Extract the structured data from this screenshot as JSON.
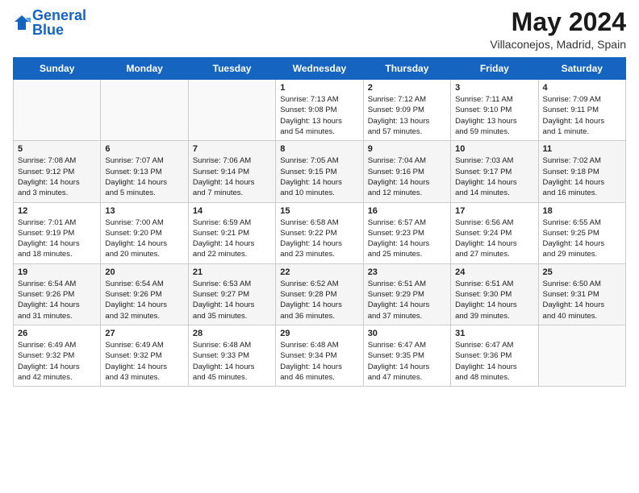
{
  "header": {
    "logo_line1": "General",
    "logo_line2": "Blue",
    "month_year": "May 2024",
    "location": "Villaconejos, Madrid, Spain"
  },
  "weekdays": [
    "Sunday",
    "Monday",
    "Tuesday",
    "Wednesday",
    "Thursday",
    "Friday",
    "Saturday"
  ],
  "weeks": [
    [
      {
        "day": "",
        "info": ""
      },
      {
        "day": "",
        "info": ""
      },
      {
        "day": "",
        "info": ""
      },
      {
        "day": "1",
        "info": "Sunrise: 7:13 AM\nSunset: 9:08 PM\nDaylight: 13 hours\nand 54 minutes."
      },
      {
        "day": "2",
        "info": "Sunrise: 7:12 AM\nSunset: 9:09 PM\nDaylight: 13 hours\nand 57 minutes."
      },
      {
        "day": "3",
        "info": "Sunrise: 7:11 AM\nSunset: 9:10 PM\nDaylight: 13 hours\nand 59 minutes."
      },
      {
        "day": "4",
        "info": "Sunrise: 7:09 AM\nSunset: 9:11 PM\nDaylight: 14 hours\nand 1 minute."
      }
    ],
    [
      {
        "day": "5",
        "info": "Sunrise: 7:08 AM\nSunset: 9:12 PM\nDaylight: 14 hours\nand 3 minutes."
      },
      {
        "day": "6",
        "info": "Sunrise: 7:07 AM\nSunset: 9:13 PM\nDaylight: 14 hours\nand 5 minutes."
      },
      {
        "day": "7",
        "info": "Sunrise: 7:06 AM\nSunset: 9:14 PM\nDaylight: 14 hours\nand 7 minutes."
      },
      {
        "day": "8",
        "info": "Sunrise: 7:05 AM\nSunset: 9:15 PM\nDaylight: 14 hours\nand 10 minutes."
      },
      {
        "day": "9",
        "info": "Sunrise: 7:04 AM\nSunset: 9:16 PM\nDaylight: 14 hours\nand 12 minutes."
      },
      {
        "day": "10",
        "info": "Sunrise: 7:03 AM\nSunset: 9:17 PM\nDaylight: 14 hours\nand 14 minutes."
      },
      {
        "day": "11",
        "info": "Sunrise: 7:02 AM\nSunset: 9:18 PM\nDaylight: 14 hours\nand 16 minutes."
      }
    ],
    [
      {
        "day": "12",
        "info": "Sunrise: 7:01 AM\nSunset: 9:19 PM\nDaylight: 14 hours\nand 18 minutes."
      },
      {
        "day": "13",
        "info": "Sunrise: 7:00 AM\nSunset: 9:20 PM\nDaylight: 14 hours\nand 20 minutes."
      },
      {
        "day": "14",
        "info": "Sunrise: 6:59 AM\nSunset: 9:21 PM\nDaylight: 14 hours\nand 22 minutes."
      },
      {
        "day": "15",
        "info": "Sunrise: 6:58 AM\nSunset: 9:22 PM\nDaylight: 14 hours\nand 23 minutes."
      },
      {
        "day": "16",
        "info": "Sunrise: 6:57 AM\nSunset: 9:23 PM\nDaylight: 14 hours\nand 25 minutes."
      },
      {
        "day": "17",
        "info": "Sunrise: 6:56 AM\nSunset: 9:24 PM\nDaylight: 14 hours\nand 27 minutes."
      },
      {
        "day": "18",
        "info": "Sunrise: 6:55 AM\nSunset: 9:25 PM\nDaylight: 14 hours\nand 29 minutes."
      }
    ],
    [
      {
        "day": "19",
        "info": "Sunrise: 6:54 AM\nSunset: 9:26 PM\nDaylight: 14 hours\nand 31 minutes."
      },
      {
        "day": "20",
        "info": "Sunrise: 6:54 AM\nSunset: 9:26 PM\nDaylight: 14 hours\nand 32 minutes."
      },
      {
        "day": "21",
        "info": "Sunrise: 6:53 AM\nSunset: 9:27 PM\nDaylight: 14 hours\nand 35 minutes."
      },
      {
        "day": "22",
        "info": "Sunrise: 6:52 AM\nSunset: 9:28 PM\nDaylight: 14 hours\nand 36 minutes."
      },
      {
        "day": "23",
        "info": "Sunrise: 6:51 AM\nSunset: 9:29 PM\nDaylight: 14 hours\nand 37 minutes."
      },
      {
        "day": "24",
        "info": "Sunrise: 6:51 AM\nSunset: 9:30 PM\nDaylight: 14 hours\nand 39 minutes."
      },
      {
        "day": "25",
        "info": "Sunrise: 6:50 AM\nSunset: 9:31 PM\nDaylight: 14 hours\nand 40 minutes."
      }
    ],
    [
      {
        "day": "26",
        "info": "Sunrise: 6:49 AM\nSunset: 9:32 PM\nDaylight: 14 hours\nand 42 minutes."
      },
      {
        "day": "27",
        "info": "Sunrise: 6:49 AM\nSunset: 9:32 PM\nDaylight: 14 hours\nand 43 minutes."
      },
      {
        "day": "28",
        "info": "Sunrise: 6:48 AM\nSunset: 9:33 PM\nDaylight: 14 hours\nand 45 minutes."
      },
      {
        "day": "29",
        "info": "Sunrise: 6:48 AM\nSunset: 9:34 PM\nDaylight: 14 hours\nand 46 minutes."
      },
      {
        "day": "30",
        "info": "Sunrise: 6:47 AM\nSunset: 9:35 PM\nDaylight: 14 hours\nand 47 minutes."
      },
      {
        "day": "31",
        "info": "Sunrise: 6:47 AM\nSunset: 9:36 PM\nDaylight: 14 hours\nand 48 minutes."
      },
      {
        "day": "",
        "info": ""
      }
    ]
  ]
}
